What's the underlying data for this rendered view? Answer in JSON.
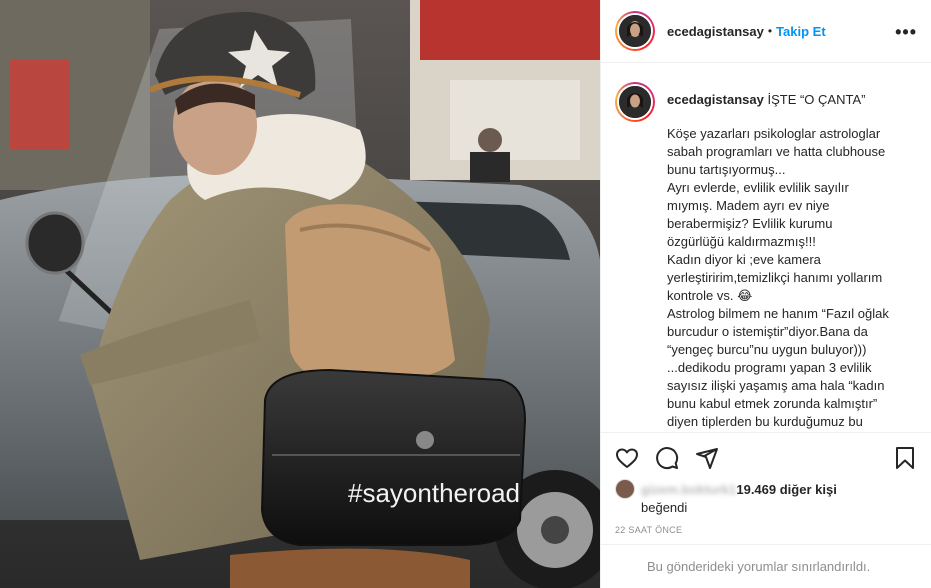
{
  "post": {
    "photo_overlay_text": "#sayontheroad"
  },
  "header": {
    "username": "ecedagistansay",
    "separator": "•",
    "follow_label": "Takip Et",
    "more_label": "•••"
  },
  "caption": {
    "username": "ecedagistansay",
    "title": "İŞTE “O ÇANTA”",
    "lines": [
      "Köşe yazarları psikologlar astrologlar",
      "sabah programları ve hatta clubhouse",
      "bunu tartışıyormuş...",
      "Ayrı evlerde, evlilik evlilik sayılır",
      "mıymış. Madem ayrı ev niye",
      "berabermişiz? Evlilik kurumu",
      "özgürlüğü kaldırmazmış!!!",
      "Kadın diyor ki ;eve kamera",
      "yerleştiririm,temizlikçi hanımı yollarım",
      "kontrole vs. 😂",
      "Astrolog bilmem ne hanım “Fazıl oğlak",
      "burcudur o istemiştir”diyor.Bana da",
      "“yengeç burcu”nu uygun buluyor)))",
      "...dedikodu programı yapan 3 evlilik",
      "sayısız ilişki yaşamış ama hala “kadın",
      "bunu kabul etmek zorunda kalmıştır”",
      "diyen tiplerden bu kurduğumuz bu"
    ]
  },
  "actions": {
    "icons": [
      "heart-icon",
      "comment-icon",
      "share-icon",
      "bookmark-icon"
    ]
  },
  "likes": {
    "blurred_name": "gizem.bokturk1",
    "count_text": "19.469 diğer kişi",
    "liked_text": "beğendi"
  },
  "timestamp": "22 SAAT ÖNCE",
  "comments_limited": "Bu gönderideki yorumlar sınırlandırıldı.",
  "colors": {
    "accent": "#0095f6",
    "text": "#262626",
    "muted": "#8e8e8e",
    "border": "#efefef"
  }
}
